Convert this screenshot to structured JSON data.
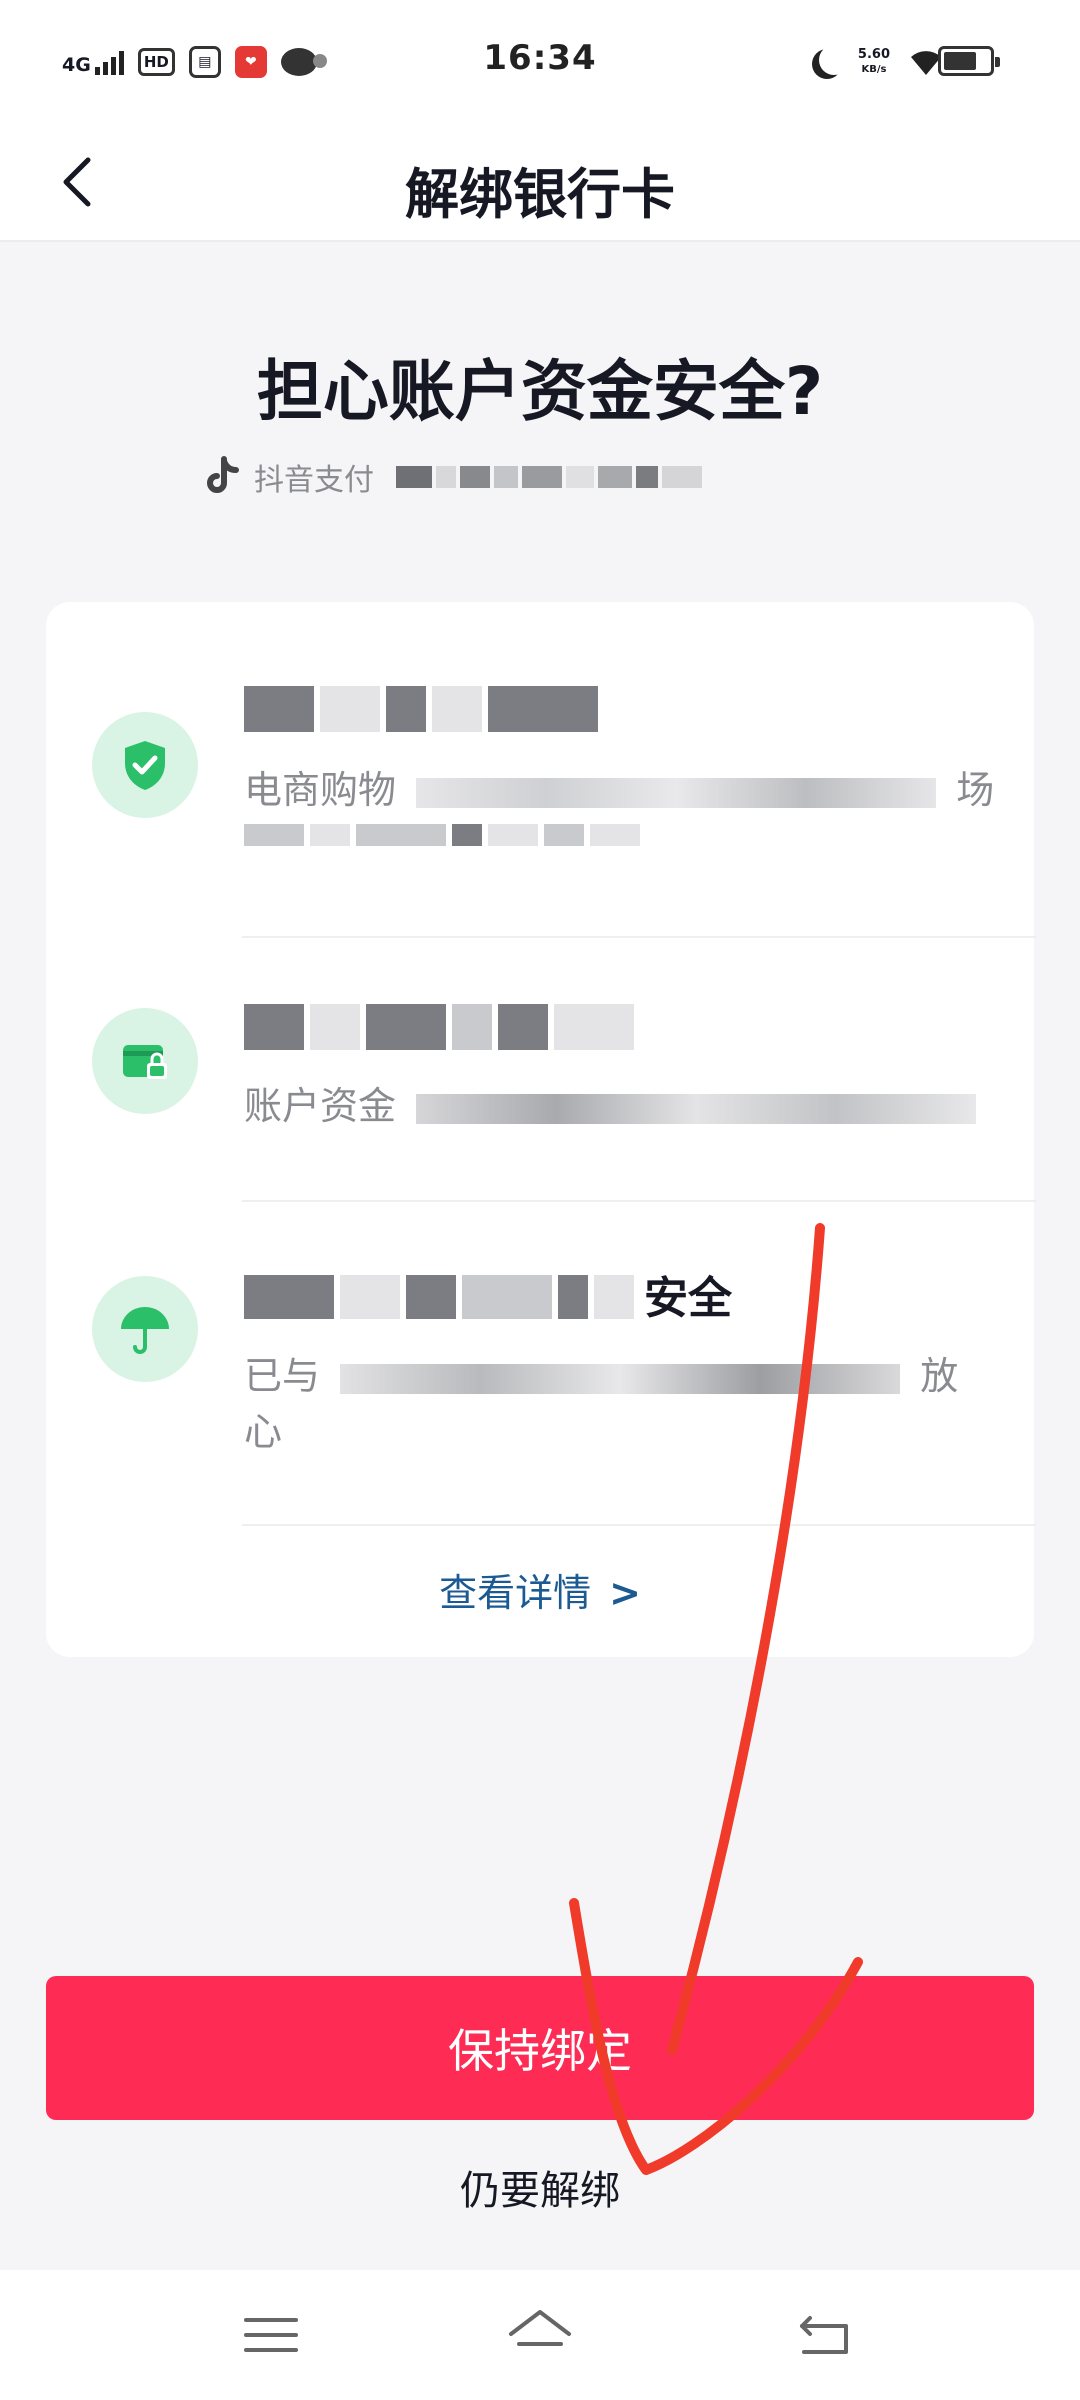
{
  "status_bar": {
    "network": "4G",
    "hd": "HD",
    "time": "16:34",
    "speed_value": "5.60",
    "speed_unit": "KB/s"
  },
  "nav": {
    "title": "解绑银行卡"
  },
  "hero": {
    "title": "担心账户资金安全?",
    "subtitle": "抖音支付"
  },
  "features": [
    {
      "icon": "shield-check-icon",
      "title": "",
      "desc": "电商购物",
      "desc_tail": "场"
    },
    {
      "icon": "wallet-lock-icon",
      "title": "",
      "desc": "账户资金"
    },
    {
      "icon": "umbrella-icon",
      "title": "安全",
      "desc": "已与",
      "desc_tail": "放",
      "desc_line2": "心"
    }
  ],
  "card": {
    "details_label": "查看详情"
  },
  "actions": {
    "keep_label": "保持绑定",
    "unbind_label": "仍要解绑"
  },
  "colors": {
    "primary": "#fe2c55",
    "link": "#1b5a93",
    "icon_bg": "#d9f4e4",
    "icon_green": "#2bbf6a",
    "annotation": "#f03a2a"
  }
}
